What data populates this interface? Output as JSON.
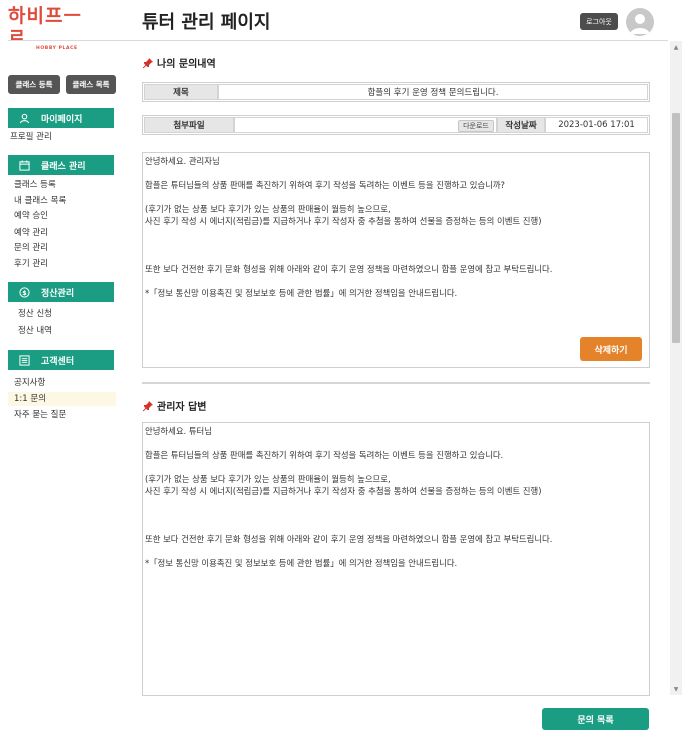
{
  "logo": {
    "main": "하비프ㅡㄹ",
    "sub": "HOBBY PLACE"
  },
  "header": {
    "title": "튜터 관리 페이지",
    "logout_label": "로그아웃"
  },
  "sidebar": {
    "top_buttons": [
      "클래스 등록",
      "클래스 목록"
    ],
    "sections": [
      {
        "heading": "마이페이지",
        "icon": "user-icon",
        "items": [
          "프로필 관리"
        ]
      },
      {
        "heading": "클래스 관리",
        "icon": "calendar-icon",
        "items": [
          "클래스 등록",
          "내 클래스 목록",
          "예약 승인",
          "예약 관리",
          "문의 관리",
          "후기 관리"
        ]
      },
      {
        "heading": "정산관리",
        "icon": "coin-icon",
        "items": [
          "정산 신청",
          "정산 내역"
        ]
      },
      {
        "heading": "고객센터",
        "icon": "list-icon",
        "items": [
          "공지사항",
          "1:1 문의",
          "자주 묻는 질문"
        ]
      }
    ],
    "active_item": "1:1 문의"
  },
  "inquiry": {
    "section_title": "나의 문의내역",
    "title_label": "제목",
    "title_value": "합플의 후기 운영 정책 문의드립니다.",
    "attachment_label": "첨부파일",
    "attachment_value": "",
    "download_label": "다운로드",
    "date_label": "작성날짜",
    "date_value": "2023-01-06 17:01",
    "body": {
      "line1": "안녕하세요. 관리자님",
      "line2": "합플은 튜터님들의 상품 판매를 촉진하기 위하여 후기 작성을 독려하는 이벤트 등을 진행하고 있습니까?",
      "line3": "(후기가 없는 상품 보다 후기가 있는 상품의 판매율이 월등히 높으므로,",
      "line4": "사진 후기 작성 시 에너지(적립금)를 지급하거나 후기 작성자 중 추첨을 통하여 선물을 증정하는 등의 이벤트 진행)",
      "line5": "또한 보다 건전한 후기 문화 형성을 위해 아래와 같이 후기 운영 정책을 마련하였으니 합플 운영에 참고 부탁드립니다.",
      "line6": "*「정보 통신망 이용촉진 및 정보보호 등에 관한 법률」에 의거한 정책임을 안내드립니다."
    },
    "delete_label": "삭제하기"
  },
  "answer": {
    "section_title": "관리자 답변",
    "body": {
      "line1": "안녕하세요. 튜터님",
      "line2": "합플은 튜터님들의 상품 판매를 촉진하기 위하여 후기 작성을 독려하는 이벤트 등을 진행하고 있습니다.",
      "line3": "(후기가 없는 상품 보다 후기가 있는 상품의 판매율이 월등히 높으므로,",
      "line4": "사진 후기 작성 시 에너지(적립금)를 지급하거나 후기 작성자 중 추첨을 통하여 선물을 증정하는 등의 이벤트 진행)",
      "line5": "또한 보다 건전한 후기 문화 형성을 위해 아래와 같이 후기 운영 정책을 마련하였으니 합플 운영에 참고 부탁드립니다.",
      "line6": "*「정보 통신망 이용촉진 및 정보보호 등에 관한 법률」에 의거한 정책임을 안내드립니다."
    }
  },
  "footer": {
    "list_label": "문의 목록"
  },
  "colors": {
    "accent": "#1a9d82",
    "danger": "#e5832a",
    "logo": "#e04a3c"
  }
}
